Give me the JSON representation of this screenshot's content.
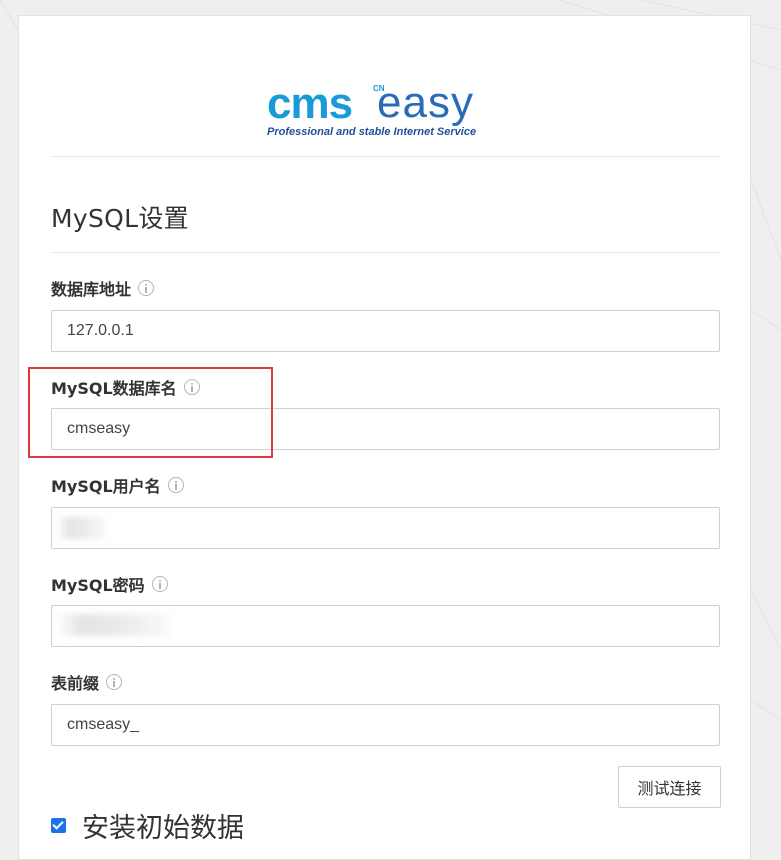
{
  "logo": {
    "brand_cms": "cms",
    "brand_easy": "easy",
    "brand_badge": "CN",
    "tagline": "Professional and stable Internet Service",
    "colors": {
      "cms_blue": "#1a9ad6",
      "easy_blue": "#2a6cb8",
      "tagline": "#1e4f9a"
    }
  },
  "section": {
    "title": "MySQL设置"
  },
  "fields": {
    "db_host": {
      "label": "数据库地址",
      "value": "127.0.0.1"
    },
    "db_name": {
      "label": "MySQL数据库名",
      "value": "cmseasy"
    },
    "db_user": {
      "label": "MySQL用户名",
      "value": ""
    },
    "db_password": {
      "label": "MySQL密码",
      "value": ""
    },
    "table_prefix": {
      "label": "表前缀",
      "value": "cmseasy_"
    }
  },
  "actions": {
    "test_connection": "测试连接"
  },
  "install_sample": {
    "label": "安装初始数据",
    "checked": true
  },
  "colors": {
    "highlight": "#e0393e",
    "checkbox": "#1a73e8"
  }
}
